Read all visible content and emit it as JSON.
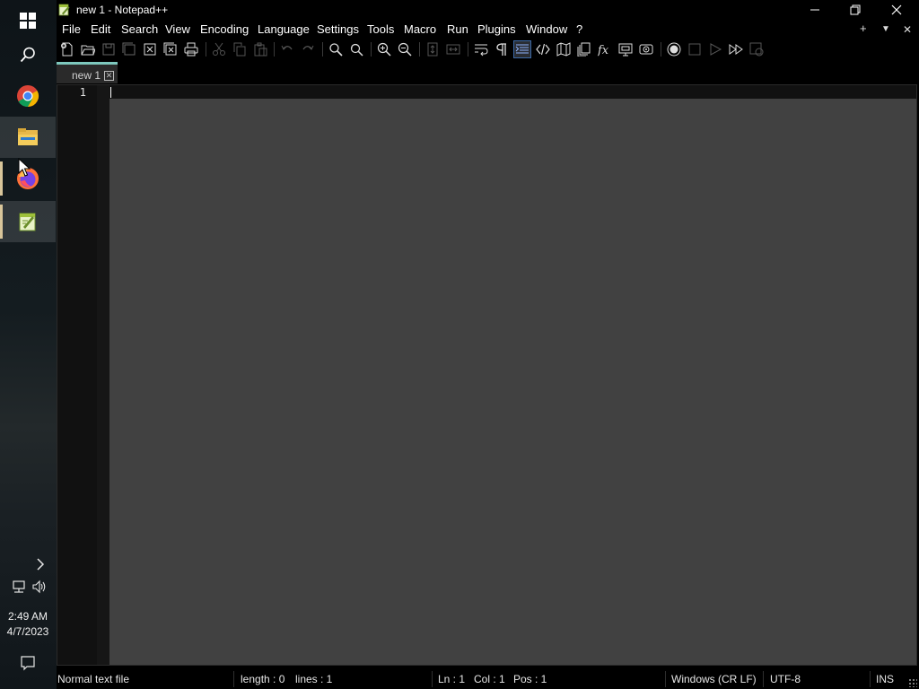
{
  "window": {
    "title": "new 1 - Notepad++"
  },
  "menu": {
    "items": [
      "File",
      "Edit",
      "Search",
      "View",
      "Encoding",
      "Language",
      "Settings",
      "Tools",
      "Macro",
      "Run",
      "Plugins",
      "Window",
      "?"
    ],
    "right_controls": [
      "+",
      "▼",
      "✕"
    ]
  },
  "toolbar": {
    "icons": [
      "new-file",
      "open-file",
      "save",
      "save-all",
      "close",
      "close-all",
      "print",
      "cut",
      "copy",
      "paste",
      "undo",
      "redo",
      "find",
      "replace",
      "zoom-in",
      "zoom-out",
      "sync-vertical",
      "sync-horizontal",
      "word-wrap",
      "show-all-characters",
      "indent-guide",
      "xml-tag",
      "document-map",
      "document-list",
      "function-list",
      "folder-as-workspace",
      "monitoring",
      "start-recording",
      "stop-recording",
      "playback-macro",
      "run-macro-multiple",
      "save-macro"
    ]
  },
  "tab": {
    "label": "new 1",
    "close": "✕"
  },
  "editor": {
    "line_numbers": [
      "1"
    ]
  },
  "status": {
    "file_type": "Normal text file",
    "length": "length : 0",
    "lines": "lines : 1",
    "ln": "Ln : 1",
    "col": "Col : 1",
    "pos": "Pos : 1",
    "eol": "Windows (CR LF)",
    "encoding": "UTF-8",
    "mode": "INS"
  },
  "taskbar": {
    "apps": [
      "Chrome",
      "File Explorer",
      "Firefox",
      "Notepad++"
    ],
    "clock": {
      "time": "2:49 AM",
      "date": "4/7/2023"
    }
  },
  "colors": {
    "editor_bg": "#414141",
    "gutter_bg": "#111111",
    "tab_accent": "#7ec8be",
    "taskbar_indicator": "#d8c59a"
  }
}
